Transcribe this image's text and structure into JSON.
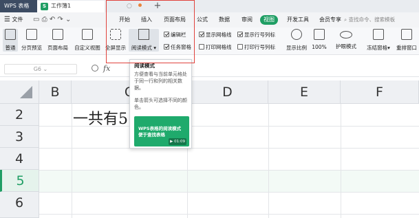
{
  "titlebar": {
    "app_tab": "WPS 表格",
    "doc_tab": "工作簿1",
    "add_tab": "+"
  },
  "menu": {
    "file": "文件",
    "items": [
      "开始",
      "插入",
      "页面布局",
      "公式",
      "数据",
      "审阅",
      "视图",
      "开发工具",
      "会员专享"
    ],
    "active": "视图",
    "search": "查找命令、搜索模板"
  },
  "toolbar": {
    "normal": "普通",
    "page_break_preview": "分页预览",
    "page_layout": "页面布局",
    "custom_view": "自定义视图",
    "fullscreen": "全屏显示",
    "reading_mode": "阅读模式",
    "checkboxes": {
      "edit_bar": "编辑栏",
      "task_pane": "任务窗格",
      "show_gridlines": "显示网格线",
      "print_gridlines": "打印网格线",
      "show_headings": "显示行号列标",
      "print_headings": "打印行号列标"
    },
    "show_ratio": "显示比例",
    "zoom_100": "100%",
    "eye_mode": "护眼模式",
    "freeze_panes": "冻结窗格",
    "rearrange": "重排窗口"
  },
  "formula_bar": {
    "namebox": "G6",
    "fx": "fx"
  },
  "grid": {
    "columns": [
      "B",
      "C",
      "D",
      "E",
      "F"
    ],
    "rows": [
      "2",
      "3",
      "4",
      "5",
      "6"
    ],
    "active_row": "5",
    "cell_text": "一共有5"
  },
  "tooltip": {
    "title": "阅读模式",
    "desc1": "方便查看与当前单元格处于同一行和列的相关数据。",
    "desc2": "单击箭头可选择不同的颜色。",
    "thumb_line1": "WPS表格的阅读模式",
    "thumb_line2": "便于查找表格",
    "thumb_duration": "01:09"
  },
  "colors": {
    "accent": "#1f9e64",
    "highlight_box": "#e0413b",
    "app_tab_bg": "#3d4c63"
  }
}
